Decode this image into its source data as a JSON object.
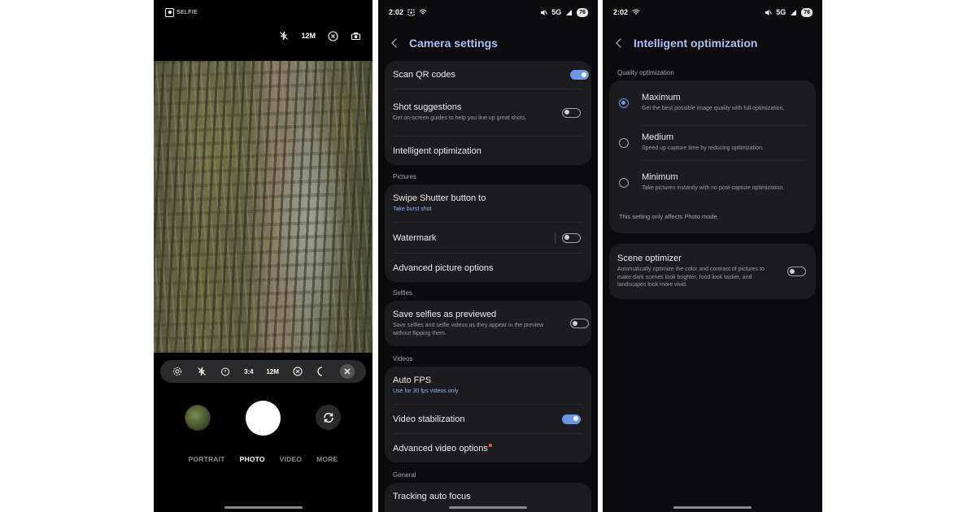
{
  "camera": {
    "selfie_label": "SELFIE",
    "top_resolution": "12M",
    "bar": {
      "ratio": "3:4",
      "resolution": "12M"
    },
    "modes": [
      "PORTRAIT",
      "PHOTO",
      "VIDEO",
      "MORE"
    ],
    "active_mode": "PHOTO"
  },
  "settings": {
    "status": {
      "time": "2:02",
      "network": "5G",
      "battery": "76"
    },
    "title": "Camera settings",
    "top_items": [
      {
        "title": "Scan QR codes",
        "toggle": true
      },
      {
        "title": "Shot suggestions",
        "sub": "Get on-screen guides to help you line up great shots.",
        "toggle": false
      },
      {
        "title": "Intelligent optimization"
      }
    ],
    "sections": {
      "pictures": "Pictures",
      "selfies": "Selfies",
      "videos": "Videos",
      "general": "General"
    },
    "pictures": [
      {
        "title": "Swipe Shutter button to",
        "sub": "Take burst shot"
      },
      {
        "title": "Watermark",
        "toggle": false
      },
      {
        "title": "Advanced picture options"
      }
    ],
    "selfies": [
      {
        "title": "Save selfies as previewed",
        "sub": "Save selfies and selfie videos as they appear in the preview without flipping them.",
        "toggle": false
      }
    ],
    "videos": [
      {
        "title": "Auto FPS",
        "sub": "Use for 30 fps videos only"
      },
      {
        "title": "Video stabilization",
        "toggle": true
      },
      {
        "title": "Advanced video options"
      }
    ],
    "general": [
      {
        "title": "Tracking auto focus"
      }
    ]
  },
  "optimization": {
    "status": {
      "time": "2:02",
      "network": "5G",
      "battery": "76"
    },
    "title": "Intelligent optimization",
    "section": "Quality optimization",
    "options": [
      {
        "title": "Maximum",
        "sub": "Get the best possible image quality with full optimization.",
        "selected": true
      },
      {
        "title": "Medium",
        "sub": "Speed up capture time by reducing optimization.",
        "selected": false
      },
      {
        "title": "Minimum",
        "sub": "Take pictures instantly with no post-capture optimization.",
        "selected": false
      }
    ],
    "note": "This setting only affects Photo mode.",
    "scene": {
      "title": "Scene optimizer",
      "sub": "Automatically optimize the color and contrast of pictures to make dark scenes look brighter, food look tastier, and landscapes look more vivid.",
      "toggle": false
    }
  },
  "colors": {
    "accent": "#6d96e8",
    "title_blue": "#a8c2f5",
    "card": "#1c1c1f"
  }
}
